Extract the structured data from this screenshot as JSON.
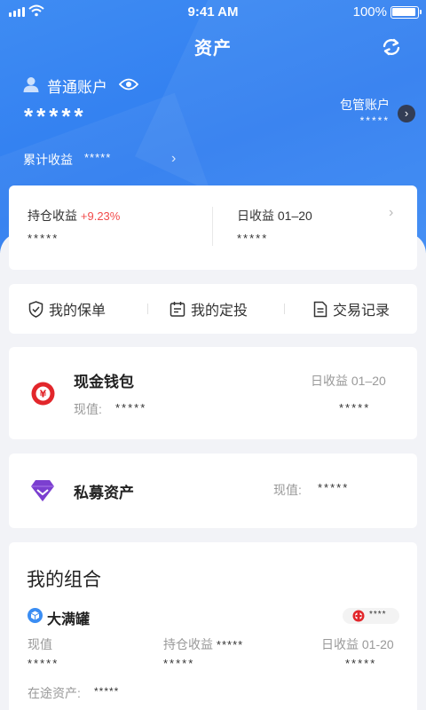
{
  "status_bar": {
    "time": "9:41 AM",
    "battery": "100%"
  },
  "nav": {
    "title": "资产"
  },
  "account": {
    "label": "普通账户",
    "value": "*****",
    "managed_label": "包管账户",
    "managed_value": "*****",
    "cumulative_label": "累计收益",
    "cumulative_value": "*****"
  },
  "position": {
    "holding_label": "持仓收益",
    "holding_rate": "+9.23%",
    "holding_value": "*****",
    "daily_label": "日收益 01–20",
    "daily_value": "*****"
  },
  "menu": {
    "policy": "我的保单",
    "fixed_invest": "我的定投",
    "records": "交易记录"
  },
  "wallet": {
    "title": "现金钱包",
    "daily_label": "日收益 01–20",
    "current_label": "现值:",
    "current_value": "*****",
    "daily_value": "*****"
  },
  "private": {
    "title": "私募资产",
    "current_label": "现值:",
    "current_value": "*****"
  },
  "portfolio": {
    "title": "我的组合",
    "item_name": "大满罐",
    "tag_value": "****",
    "col1_label": "现值",
    "col1_value": "*****",
    "col2_label": "持仓收益",
    "col2_inline": "*****",
    "col2_value": "*****",
    "col3_label": "日收益 01-20",
    "col3_value": "*****",
    "transit_label": "在途资产:",
    "transit_value": "*****"
  },
  "colors": {
    "brand_blue": "#2f7df0",
    "rate_red": "#f24b4b",
    "wallet_red": "#e2262b",
    "private_purple": "#7b3fd0"
  }
}
